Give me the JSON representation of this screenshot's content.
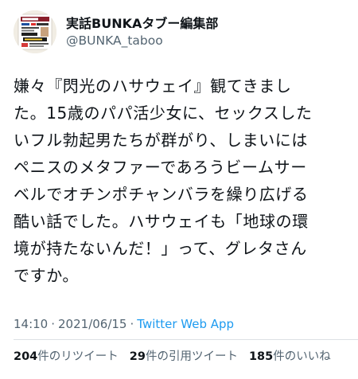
{
  "author": {
    "display_name": "実話BUNKAタブー編集部",
    "handle": "@BUNKA_taboo",
    "avatar_icon": "magazine-cover-avatar"
  },
  "tweet": {
    "lines": [
      "嫌々『閃光のハサウェイ』観てきまし",
      "た。15歳のパパ活少女に、セックスした",
      "いフル勃起男たちが群がり、しまいには",
      "ペニスのメタファーであろうビームサー",
      "ベルでオチンポチャンバラを繰り広げる",
      "酷い話でした。ハサウェイも「地球の環",
      "境が持たないんだ！」って、グレタさん",
      "ですか。"
    ]
  },
  "meta": {
    "time": "14:10",
    "separator_1": "·",
    "date": "2021/06/15",
    "separator_2": "·",
    "source": "Twitter Web App"
  },
  "stats": {
    "retweets_count": "204",
    "retweets_label": "件のリツイート",
    "quotes_count": "29",
    "quotes_label": "件の引用ツイート",
    "likes_count": "185",
    "likes_label": "件のいいね"
  },
  "colors": {
    "text": "#0f1419",
    "secondary": "#536471",
    "link": "#1d9bf0",
    "divider": "#dde1e4"
  }
}
